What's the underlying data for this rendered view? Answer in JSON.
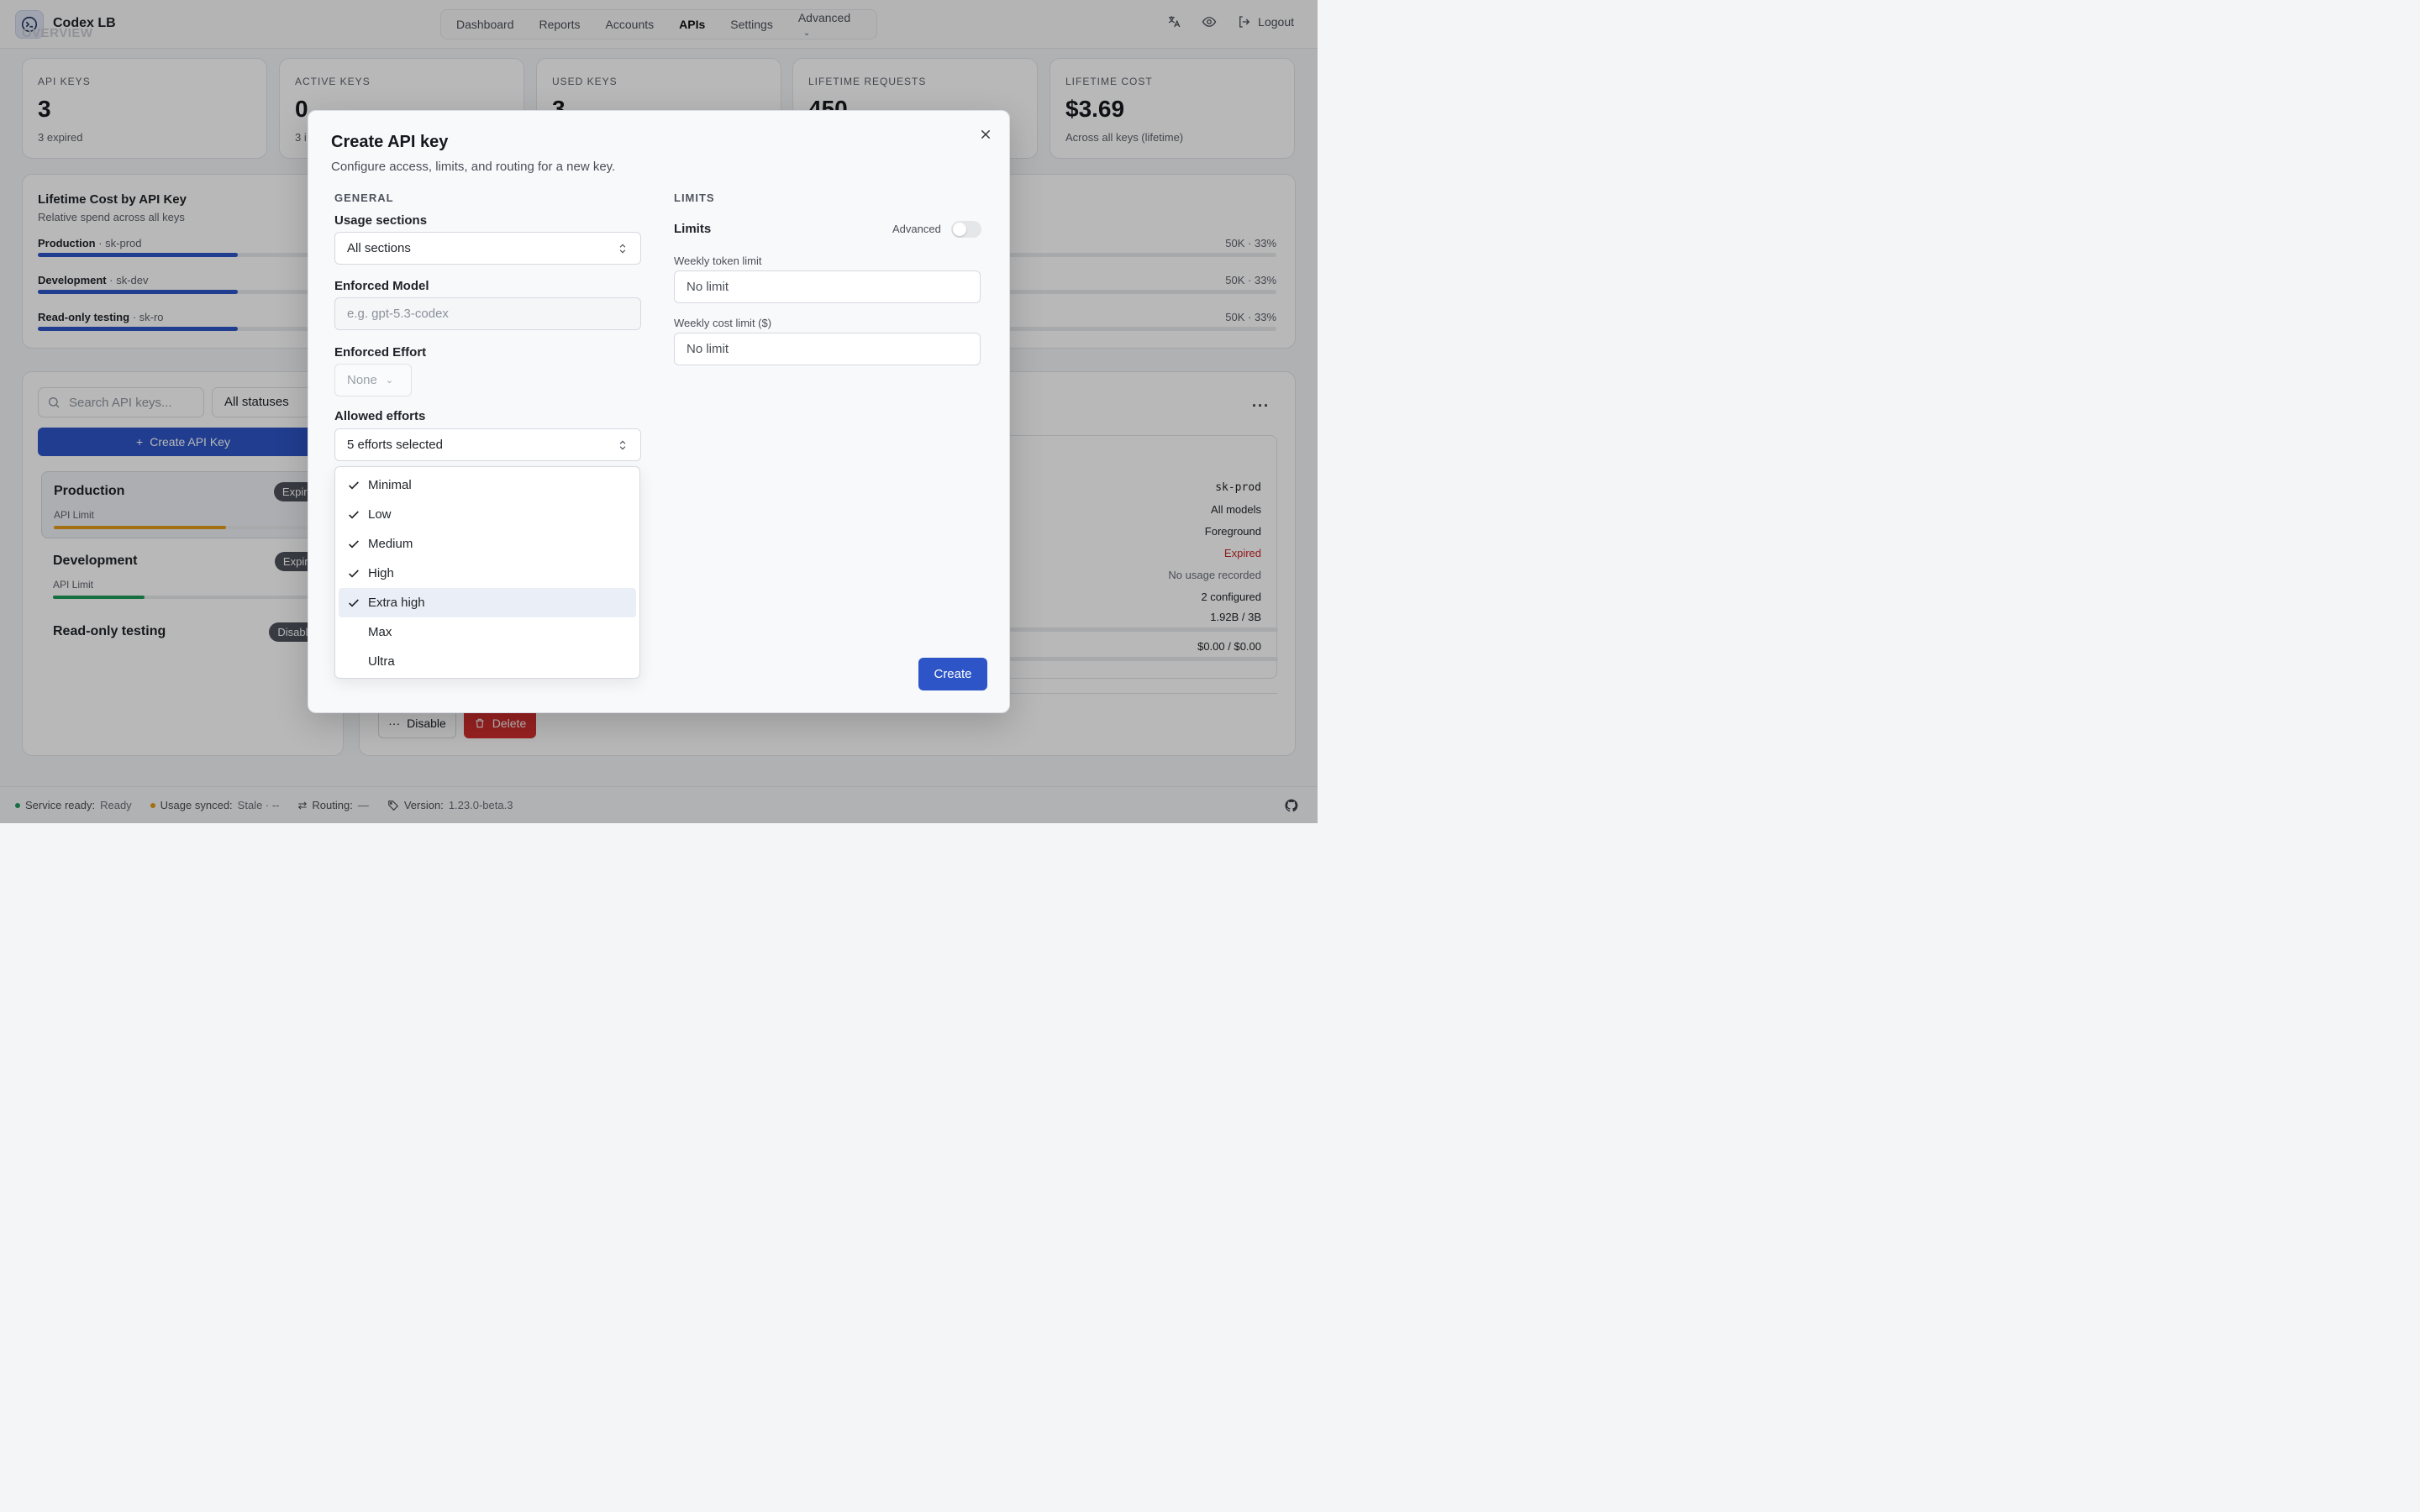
{
  "app": {
    "name": "Codex LB",
    "ghost_heading": "OVERVIEW"
  },
  "nav": {
    "tabs": [
      "Dashboard",
      "Reports",
      "Accounts",
      "APIs",
      "Settings",
      "Advanced"
    ],
    "active": "APIs",
    "logout_label": "Logout"
  },
  "stats": [
    {
      "label": "API KEYS",
      "value": "3",
      "sub": "3 expired"
    },
    {
      "label": "ACTIVE KEYS",
      "value": "0",
      "sub": "3 i"
    },
    {
      "label": "USED KEYS",
      "value": "3",
      "sub": ""
    },
    {
      "label": "LIFETIME REQUESTS",
      "value": "450",
      "sub": ""
    },
    {
      "label": "LIFETIME COST",
      "value": "$3.69",
      "sub": "Across all keys (lifetime)"
    }
  ],
  "cost_panel": {
    "title": "Lifetime Cost by API Key",
    "subtitle": "Relative spend across all keys",
    "rows": [
      {
        "name": "Production",
        "key": " · sk-prod",
        "right": "50K · 33%",
        "share": 0.33
      },
      {
        "name": "Development",
        "key": " · sk-dev",
        "right": "50K · 33%",
        "share": 0.33
      },
      {
        "name": "Read-only testing",
        "key": " · sk-ro",
        "right": "50K · 33%",
        "share": 0.33
      }
    ]
  },
  "key_list": {
    "search_placeholder": "Search API keys...",
    "status_filter": "All statuses",
    "create_label": "Create API Key",
    "items": [
      {
        "name": "Production",
        "badge": "Expired",
        "limit_label": "API Limit",
        "pct": "64",
        "usage": 0.64,
        "bar_color": "#e39a17"
      },
      {
        "name": "Development",
        "badge": "Expired",
        "limit_label": "API Limit",
        "pct": "34",
        "usage": 0.34,
        "bar_color": "#1f9a5b"
      },
      {
        "name": "Read-only testing",
        "badge": "Disabled"
      }
    ]
  },
  "detail": {
    "values": [
      "sk-prod",
      "All models",
      "Foreground",
      "Expired",
      "No usage recorded",
      "2 configured",
      "1.92B / 3B",
      "$0.00 / $0.00"
    ],
    "disable_label": "Disable",
    "delete_label": "Delete"
  },
  "footer": {
    "service_label": "Service ready:",
    "service_value": "Ready",
    "usage_label": "Usage synced:",
    "usage_value": "Stale · --",
    "routing_label": "Routing:",
    "routing_value": "—",
    "version_label": "Version:",
    "version_value": "1.23.0-beta.3",
    "colors": {
      "ready": "#1f9a5b",
      "stale": "#e39a17"
    }
  },
  "modal": {
    "title": "Create API key",
    "description": "Configure access, limits, and routing for a new key.",
    "general_heading": "GENERAL",
    "limits_heading": "LIMITS",
    "usage_sections_label": "Usage sections",
    "usage_sections_value": "All sections",
    "enforced_model_label": "Enforced Model",
    "enforced_model_placeholder": "e.g. gpt-5.3-codex",
    "enforced_effort_label": "Enforced Effort",
    "enforced_effort_value": "None",
    "allowed_efforts_label": "Allowed efforts",
    "allowed_efforts_value": "5 efforts selected",
    "limits_label": "Limits",
    "advanced_label": "Advanced",
    "advanced_enabled": false,
    "weekly_token_label": "Weekly token limit",
    "weekly_token_value": "No limit",
    "weekly_cost_label": "Weekly cost limit ($)",
    "weekly_cost_value": "No limit",
    "create_label": "Create",
    "effort_options": [
      {
        "label": "Minimal",
        "checked": true
      },
      {
        "label": "Low",
        "checked": true
      },
      {
        "label": "Medium",
        "checked": true
      },
      {
        "label": "High",
        "checked": true
      },
      {
        "label": "Extra high",
        "checked": true,
        "highlighted": true
      },
      {
        "label": "Max",
        "checked": false
      },
      {
        "label": "Ultra",
        "checked": false
      }
    ]
  },
  "colors": {
    "accent": "#2d55c7",
    "danger": "#d32f2f",
    "expired_text": "#c62828"
  }
}
